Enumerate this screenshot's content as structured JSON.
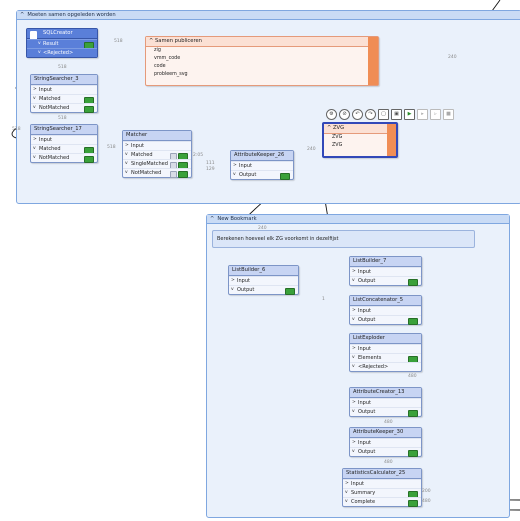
{
  "bookmark1": {
    "title": "Moeten samen opgeleden worden"
  },
  "bookmark2": {
    "title": "New Bookmark",
    "annotation": "Berekenen hoeveel elk ZG voorkomt in dezelfijst"
  },
  "sqlcreator": {
    "title": "SQLCreator",
    "ports": [
      "Result",
      "<Rejected>"
    ]
  },
  "samen": {
    "title": "Samen publiceren",
    "fields": [
      "zig",
      "vmm_code",
      "code",
      "probleem_svg"
    ]
  },
  "ss3": {
    "title": "StringSearcher_3",
    "ports": [
      "Input",
      "Matched",
      "NotMatched"
    ]
  },
  "ss17": {
    "title": "StringSearcher_17",
    "ports": [
      "Input",
      "Matched",
      "NotMatched"
    ]
  },
  "matcher": {
    "title": "Matcher",
    "ports": [
      "Input",
      "Matched",
      "SingleMatched",
      "NotMatched"
    ]
  },
  "ak26": {
    "title": "AttributeKeeper_26",
    "ports": [
      "Input",
      "Output"
    ]
  },
  "zvg": {
    "title": "ZVG",
    "fields": [
      "ZVG",
      "ZVG"
    ]
  },
  "lb7": {
    "title": "ListBuilder_7",
    "ports": [
      "Input",
      "Output"
    ]
  },
  "lb6": {
    "title": "ListBuilder_6",
    "ports": [
      "Input",
      "Output"
    ]
  },
  "lc5": {
    "title": "ListConcatenator_5",
    "ports": [
      "Input",
      "Output"
    ]
  },
  "le": {
    "title": "ListExploder",
    "ports": [
      "Input",
      "Elements",
      "<Rejected>"
    ]
  },
  "ac13": {
    "title": "AttributeCreator_13",
    "ports": [
      "Input",
      "Output"
    ]
  },
  "ak30": {
    "title": "AttributeKeeper_30",
    "ports": [
      "Input",
      "Output"
    ]
  },
  "sc25": {
    "title": "StatisticsCalculator_25",
    "ports": [
      "Input",
      "Summary",
      "Complete"
    ]
  },
  "counts": {
    "c518a": "518",
    "c518b": "518",
    "c518c": "518",
    "c518d": "518",
    "c518e": "518",
    "c205": "2:05",
    "c111": "111",
    "c129": "129",
    "c240": "240",
    "c240b": "240",
    "c240c": "240",
    "c1": "1",
    "c480": "480",
    "c480b": "480",
    "c480c": "480",
    "c200": "200",
    "c480d": "480"
  },
  "toolbar": [
    "gear-icon",
    "clock-icon",
    "undo-icon",
    "redo-icon",
    "copy-icon",
    "paste-icon",
    "run-icon",
    "step-icon",
    "stepall-icon",
    "stop-icon"
  ]
}
